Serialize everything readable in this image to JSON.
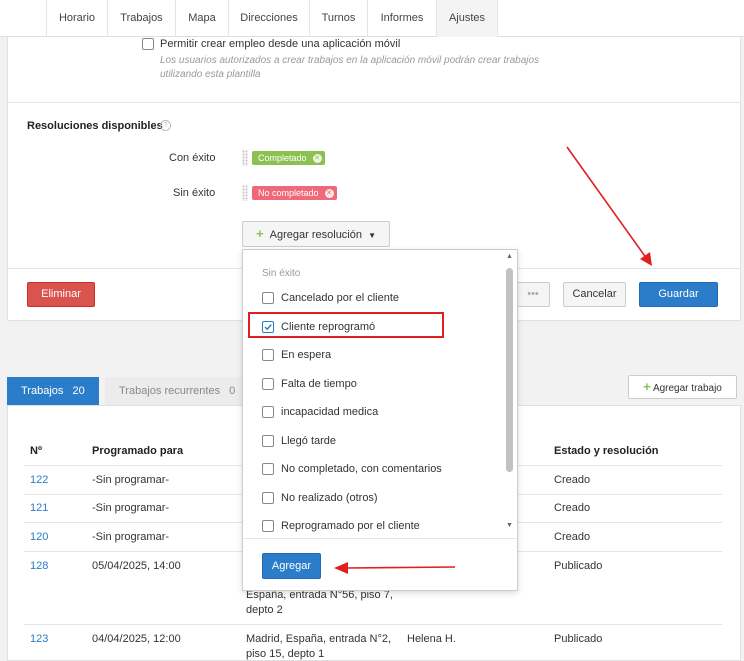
{
  "nav": {
    "tabs": [
      "Horario",
      "Trabajos",
      "Mapa",
      "Direcciones",
      "Turnos",
      "Informes",
      "Ajustes"
    ]
  },
  "template": {
    "mobile_checkbox_label": "Permitir crear empleo desde una aplicación móvil",
    "mobile_hint_line1": "Los usuarios autorizados a crear trabajos en la aplicación móvil podrán crear trabajos",
    "mobile_hint_line2": "utilizando esta plantilla",
    "resolutions_title": "Resoluciones disponibles",
    "success_label": "Con éxito",
    "success_badge": "Completado",
    "fail_label": "Sin éxito",
    "fail_badge": "No completado",
    "add_resolution_label": "Agregar resolución",
    "delete_label": "Eliminar",
    "more_label": "•••",
    "cancel_label": "Cancelar",
    "save_label": "Guardar"
  },
  "colors": {
    "success": "#8cc152",
    "fail": "#f0697a",
    "primary": "#2b7cc9",
    "danger": "#d9534f",
    "annotation": "#e02020"
  },
  "dropdown": {
    "group_label": "Sin éxito",
    "items": [
      {
        "label": "Cancelado por el cliente",
        "checked": false
      },
      {
        "label": "Cliente reprogramó",
        "checked": true
      },
      {
        "label": "En espera",
        "checked": false
      },
      {
        "label": "Falta de tiempo",
        "checked": false
      },
      {
        "label": "incapacidad medica",
        "checked": false
      },
      {
        "label": "Llegó tarde",
        "checked": false
      },
      {
        "label": "No completado, con comentarios",
        "checked": false
      },
      {
        "label": "No realizado (otros)",
        "checked": false
      },
      {
        "label": "Reprogramado por el cliente",
        "checked": false
      }
    ],
    "add_label": "Agregar"
  },
  "jobs": {
    "tab_jobs_label": "Trabajos",
    "tab_jobs_count": "20",
    "tab_recurring_label": "Trabajos recurrentes",
    "tab_recurring_count": "0",
    "add_job_label": "Agregar trabajo",
    "columns": [
      "Nº",
      "Programado para",
      "Estado y resolución"
    ],
    "rows": [
      {
        "id": "122",
        "scheduled": "-Sin programar-",
        "address": "",
        "worker": "",
        "status": "Creado"
      },
      {
        "id": "121",
        "scheduled": "-Sin programar-",
        "address": "",
        "worker": "",
        "status": "Creado"
      },
      {
        "id": "120",
        "scheduled": "-Sin programar-",
        "address": "",
        "worker": "",
        "status": "Creado"
      },
      {
        "id": "128",
        "scheduled": "05/04/2025, 14:00",
        "address": "España, entrada N°56, piso 7, depto 2",
        "worker": "",
        "status": "Publicado"
      },
      {
        "id": "123",
        "scheduled": "04/04/2025, 12:00",
        "address": "Madrid, España, entrada N°2, piso 15, depto 1",
        "worker": "Helena H.",
        "status": "Publicado"
      }
    ]
  }
}
